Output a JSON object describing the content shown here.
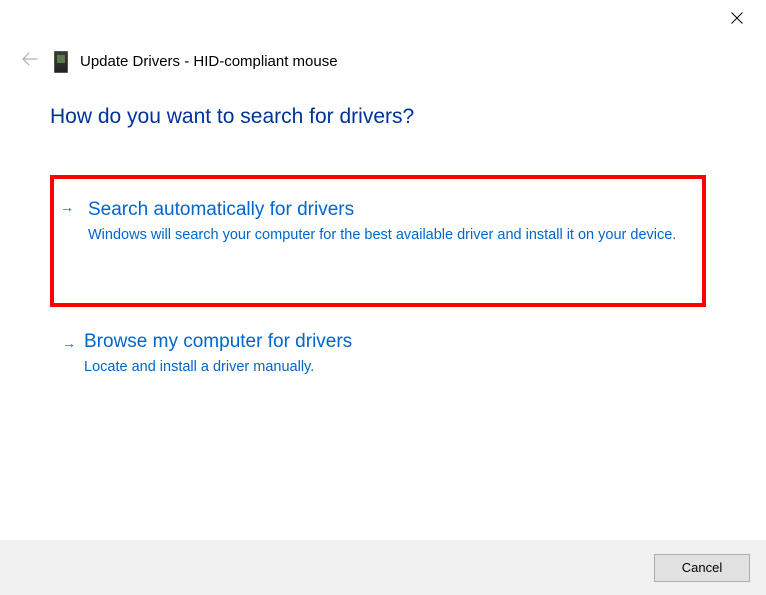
{
  "window": {
    "title": "Update Drivers - HID-compliant mouse"
  },
  "heading": "How do you want to search for drivers?",
  "options": [
    {
      "title": "Search automatically for drivers",
      "description": "Windows will search your computer for the best available driver and install it on your device."
    },
    {
      "title": "Browse my computer for drivers",
      "description": "Locate and install a driver manually."
    }
  ],
  "footer": {
    "cancel_label": "Cancel"
  },
  "colors": {
    "link_blue": "#0066cc",
    "heading_blue": "#003399",
    "highlight_border": "#ff0000"
  }
}
